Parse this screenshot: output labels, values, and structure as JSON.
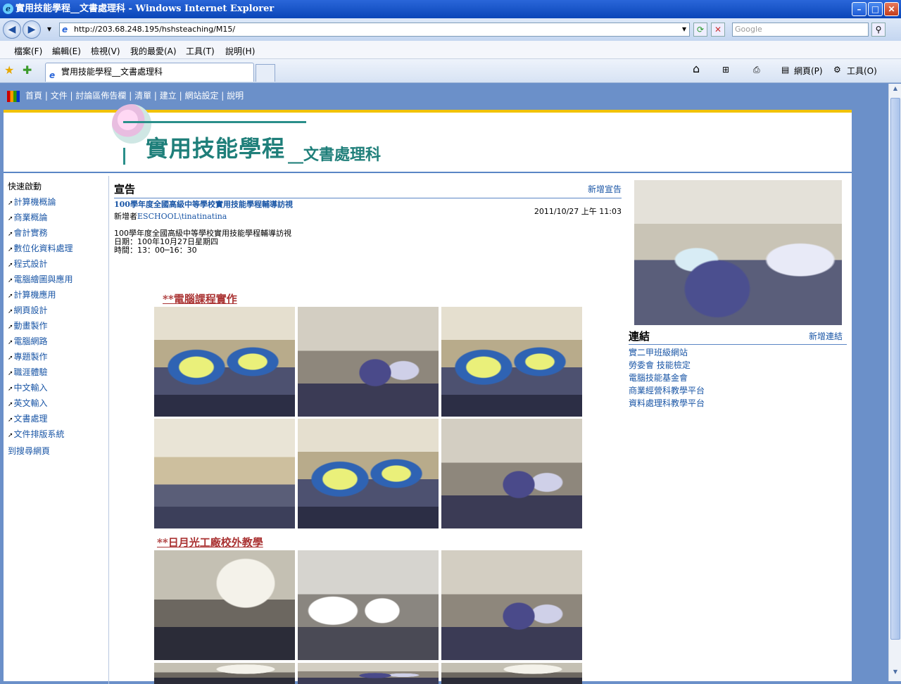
{
  "window": {
    "title": "實用技能學程__文書處理科 - Windows Internet Explorer",
    "ie_glyph": "e",
    "min": "–",
    "max": "□",
    "close": "✕"
  },
  "address": {
    "url": "http://203.68.248.195/hshsteaching/M15/",
    "search_placeholder": "Google",
    "back": "◀",
    "forward": "▶",
    "dropdown": "▾",
    "refresh": "⟳",
    "stop": "✕",
    "search_btn": "⚲"
  },
  "menu": {
    "items": [
      "檔案(F)",
      "編輯(E)",
      "檢視(V)",
      "我的最愛(A)",
      "工具(T)",
      "說明(H)"
    ]
  },
  "tabs": {
    "active": "實用技能學程__文書處理科"
  },
  "commandbar": {
    "home": "⌂",
    "feeds": "⊞",
    "print": "⎙",
    "page": "網頁(P)",
    "tools": "工具(O)"
  },
  "site": {
    "nav": [
      "首頁",
      "文件",
      "討論區佈告欄",
      "清單",
      "建立",
      "網站設定",
      "說明"
    ],
    "banner_title": "實用技能學程",
    "banner_sub": "__文書處理科",
    "quick_title": "快速啟動",
    "quick_links": [
      "計算機概論",
      "商業概論",
      "會計實務",
      "數位化資料處理",
      "程式設計",
      "電腦繪圖與應用",
      "計算機應用",
      "網頁設計",
      "動畫製作",
      "電腦網路",
      "專題製作",
      "職涯體驗",
      "中文輸入",
      "英文輸入",
      "文書處理",
      "文件排版系統"
    ],
    "search_link": "到搜尋網頁"
  },
  "announcement": {
    "heading": "宣告",
    "new_link": "新增宣告",
    "subject": "100學年度全國高級中等學校實用技能學程輔導訪視",
    "by_label": "新增者",
    "by_user": "ESCHOOL\\tinatinatina",
    "date": "2011/10/27 上午 11:03",
    "body1": "100學年度全國高級中等學校實用技能學程輔導訪視",
    "body2": "日期：100年10月27日星期四",
    "body3": "時間：13：00─16：30",
    "section1": "**電腦課程實作",
    "section2": "**日月光工廠校外教學"
  },
  "links": {
    "heading": "連結",
    "new_link": "新增連結",
    "items": [
      "實二甲班級網站",
      "勞委會 技能檢定",
      "電腦技能基金會",
      "商業經營科教學平台",
      "資料處理科教學平台"
    ]
  }
}
